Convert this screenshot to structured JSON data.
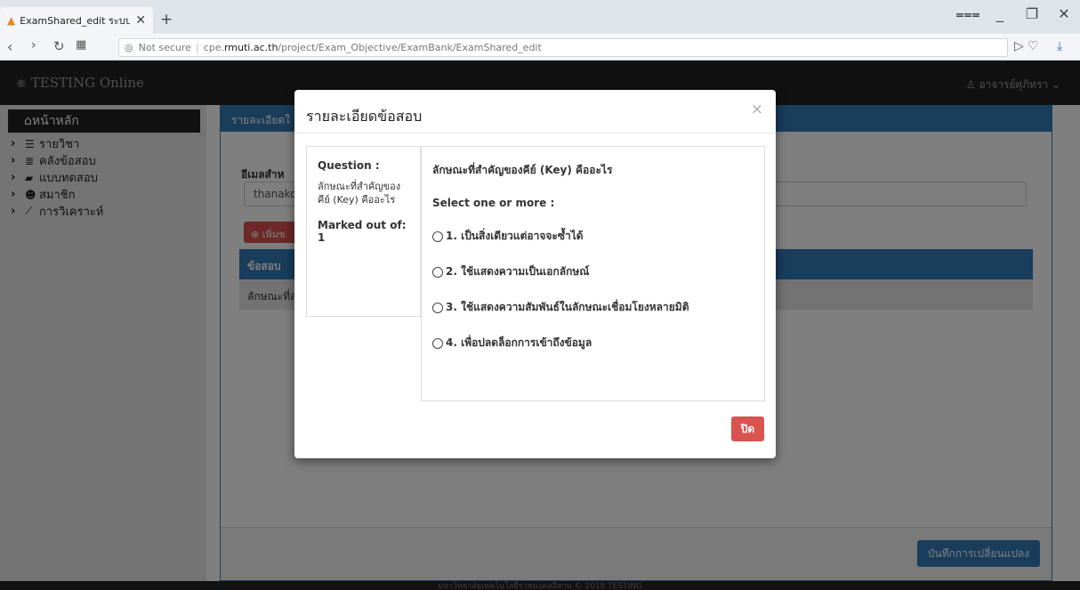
{
  "browser": {
    "tab_title": "ExamShared_edit ระบบวิเคร",
    "tab_close": "✕",
    "new_tab": "+",
    "url_security": "Not secure",
    "url_sep": "|",
    "url_pre": "cpe.",
    "url_host": "rmuti.ac.th",
    "url_path": "/project/Exam_Objective/ExamBank/ExamShared_edit"
  },
  "navbar": {
    "brand": "TESTING Online",
    "user": "อาจารย์ศุภิทรา"
  },
  "sidebar": {
    "home": "หน้าหลัก",
    "items": [
      {
        "label": "รายวิชา"
      },
      {
        "label": "คลังข้อสอบ"
      },
      {
        "label": "แบบทดสอบ"
      },
      {
        "label": "สมาชิก"
      },
      {
        "label": "การวิเคราะห์"
      }
    ]
  },
  "panel": {
    "heading": "รายละเอียดใ",
    "email_label": "อีเมลสำห",
    "email_value": "thanako",
    "add_button": "เพิ่มข",
    "table_header": "ข้อสอบ",
    "table_row": "ลักษณะที่ส",
    "save_button": "บันทึกการเปลี่ยนแปลง"
  },
  "footer": {
    "text": "มหาวิทยาลัยเทคโนโลยีราชมงคลอีสาน © 2018 TESTING"
  },
  "modal": {
    "title": "รายละเอียดข้อสอบ",
    "close_x": "×",
    "info": {
      "question_label": "Question :",
      "question_text": "ลักษณะที่สำคัญของคีย์ (Key) คืออะไร",
      "marked": "Marked out of: 1"
    },
    "question": "ลักษณะที่สำคัญของคีย์ (Key) คืออะไร",
    "select_text": "Select one or more :",
    "options": [
      {
        "label": "1.  เป็นสิ่งเดียวแต่อาจจะซ้ำได้"
      },
      {
        "label": "2.  ใช้แสดงความเป็นเอกลักษณ์"
      },
      {
        "label": "3.  ใช้แสดงความสัมพันธ์ในลักษณะเชื่อมโยงหลายมิติ"
      },
      {
        "label": "4.  เพื่อปลดล็อกการเข้าถึงข้อมูล"
      }
    ],
    "close_button": "ปิด"
  }
}
